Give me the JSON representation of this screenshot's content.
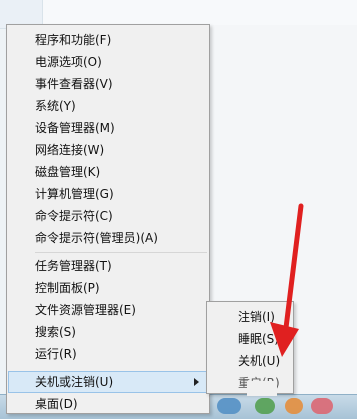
{
  "menu": {
    "items": [
      {
        "label": "程序和功能(F)"
      },
      {
        "label": "电源选项(O)"
      },
      {
        "label": "事件查看器(V)"
      },
      {
        "label": "系统(Y)"
      },
      {
        "label": "设备管理器(M)"
      },
      {
        "label": "网络连接(W)"
      },
      {
        "label": "磁盘管理(K)"
      },
      {
        "label": "计算机管理(G)"
      },
      {
        "label": "命令提示符(C)"
      },
      {
        "label": "命令提示符(管理员)(A)"
      },
      {
        "label": "任务管理器(T)"
      },
      {
        "label": "控制面板(P)"
      },
      {
        "label": "文件资源管理器(E)"
      },
      {
        "label": "搜索(S)"
      },
      {
        "label": "运行(R)"
      },
      {
        "label": "关机或注销(U)"
      },
      {
        "label": "桌面(D)"
      }
    ],
    "highlighted_item": "关机或注销(U)"
  },
  "submenu": {
    "items": [
      {
        "label": "注销(I)"
      },
      {
        "label": "睡眠(S)"
      },
      {
        "label": "关机(U)"
      },
      {
        "label": "重启(R)"
      }
    ]
  },
  "annotation": {
    "arrow_color": "#e02020"
  }
}
